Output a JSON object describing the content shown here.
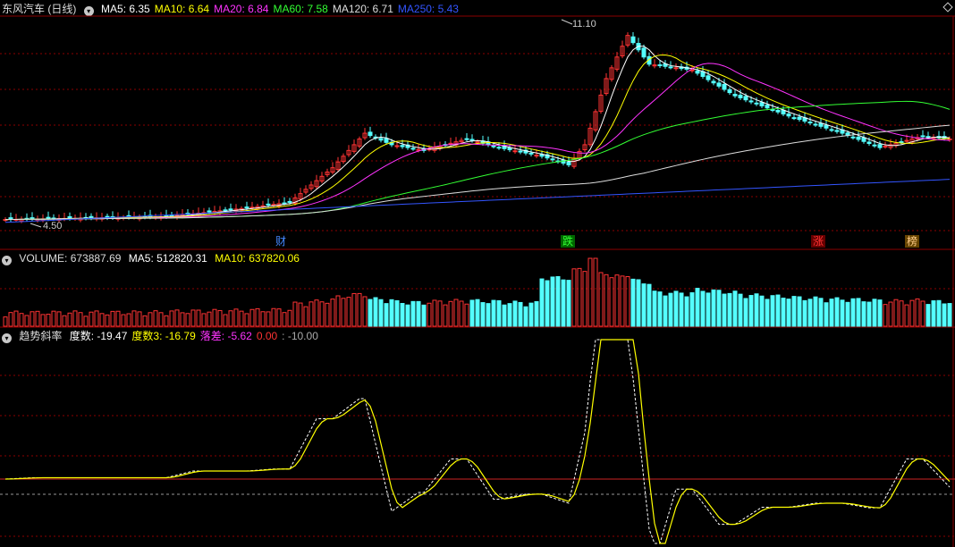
{
  "panel1": {
    "title": "东风汽车 (日线)",
    "ma": [
      {
        "label": "MA5: 6.35",
        "color": "#ffffff"
      },
      {
        "label": "MA10: 6.64",
        "color": "#ffff00"
      },
      {
        "label": "MA20: 6.84",
        "color": "#ff33ff"
      },
      {
        "label": "MA60: 7.58",
        "color": "#33ff33"
      },
      {
        "label": "MA120: 6.71",
        "color": "#dddddd"
      },
      {
        "label": "MA250: 5.43",
        "color": "#3355ff"
      }
    ],
    "high_label": "11.10",
    "low_label": "4.50",
    "tags": [
      {
        "text": "财",
        "color": "#4488ff",
        "bg": "#000"
      },
      {
        "text": "跌",
        "color": "#33ff33",
        "bg": "#006600"
      },
      {
        "text": "涨",
        "color": "#ff3333",
        "bg": "#660000"
      },
      {
        "text": "榜",
        "color": "#ffcc88",
        "bg": "#664400"
      }
    ]
  },
  "panel2": {
    "name": "VOLUME: 673887.69",
    "ma5": "MA5: 512820.31",
    "ma10": "MA10: 637820.06"
  },
  "panel3": {
    "name": "趋势斜率",
    "items": [
      {
        "label": "度数: -19.47",
        "color": "#ffffff"
      },
      {
        "label": "度数3: -16.79",
        "color": "#ffff00"
      },
      {
        "label": "落差: -5.62",
        "color": "#ff33ff"
      },
      {
        "label": "0.00",
        "color": "#ff3333"
      },
      {
        "label": ": -10.00",
        "color": "#aaaaaa"
      }
    ]
  },
  "colors": {
    "up": "#ff3333",
    "down": "#54ffff",
    "grid": "#8b0000"
  }
}
